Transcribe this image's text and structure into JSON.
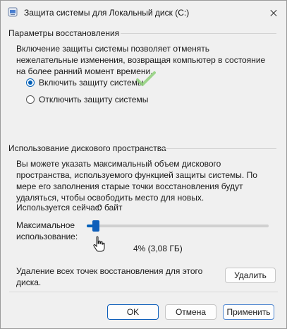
{
  "window": {
    "title": "Защита системы для Локальный диск (C:)"
  },
  "restore_settings": {
    "section_title": "Параметры восстановления",
    "description": "Включение защиты системы позволяет отменять нежелательные изменения, возвращая компьютер в состояние на более ранний момент времени.",
    "options": [
      {
        "label": "Включить защиту системы",
        "selected": true
      },
      {
        "label": "Отключить защиту системы",
        "selected": false
      }
    ]
  },
  "disk_usage": {
    "section_title": "Использование дискового пространства",
    "description": "Вы можете указать максимальный объем дискового пространства, используемого функцией защиты системы. По мере его заполнения старые точки восстановления будут удаляться, чтобы освободить место для новых.",
    "current_usage_label": "Используется сейчас:",
    "current_usage_value": "0 байт",
    "max_usage_label": "Максимальное использование:",
    "slider_percent": 4,
    "slider_value_text": "4% (3,08 ГБ)",
    "delete_text": "Удаление всех точек восстановления для этого диска.",
    "delete_button": "Удалить"
  },
  "footer": {
    "ok_button": "OK",
    "cancel_button": "Отмена",
    "apply_button": "Применить"
  },
  "colors": {
    "accent": "#005fb8",
    "check_mark": "#8fd07a",
    "background": "#f0f0f0"
  }
}
